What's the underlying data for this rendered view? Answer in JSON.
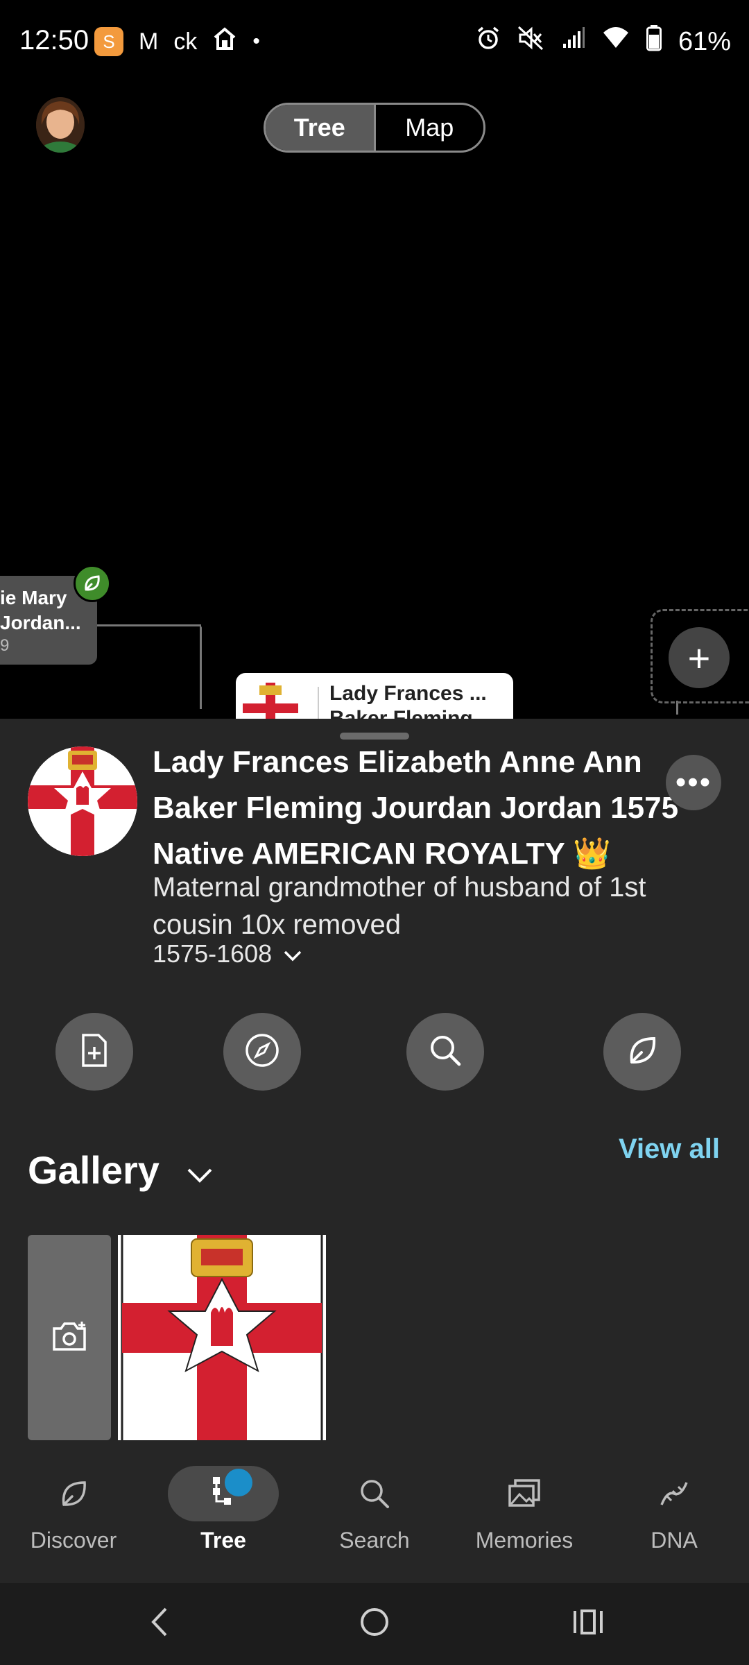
{
  "status_bar": {
    "time": "12:50",
    "badge": "S",
    "gmail_glyph": "M",
    "ck_text": "ck",
    "battery": "61%"
  },
  "header": {
    "tabs": [
      "Tree",
      "Map"
    ],
    "active_tab": "Tree"
  },
  "tree": {
    "left_card": {
      "name_line1": "ie Mary",
      "name_line2": "Jordan...",
      "years": "9"
    },
    "focus_card": {
      "name_line1": "Lady Frances ...",
      "name_line2": "Baker Fleming"
    },
    "add_label": "+"
  },
  "profile": {
    "title": "Lady Frances Elizabeth Anne Ann Baker Fleming Jourdan Jordan 1575 Native AMERICAN ROYALTY 👑",
    "relationship": "Maternal grandmother of husband of 1st cousin 10x removed",
    "dates": "1575-1608",
    "more_label": "•••"
  },
  "actions": [
    {
      "icon": "add-document-icon"
    },
    {
      "icon": "compass-icon"
    },
    {
      "icon": "search-icon"
    },
    {
      "icon": "leaf-hint-icon"
    }
  ],
  "gallery": {
    "title": "Gallery",
    "view_all": "View all"
  },
  "bottom_nav": [
    {
      "label": "Discover",
      "icon": "leaf-icon",
      "active": false
    },
    {
      "label": "Tree",
      "icon": "tree-icon",
      "active": true
    },
    {
      "label": "Search",
      "icon": "search-icon",
      "active": false
    },
    {
      "label": "Memories",
      "icon": "photos-icon",
      "active": false
    },
    {
      "label": "DNA",
      "icon": "dna-icon",
      "active": false
    }
  ],
  "colors": {
    "background": "#000000",
    "sheet": "#262626",
    "accent_link": "#7fd3f0",
    "hint_green": "#3f8c2a",
    "notification_blue": "#1b8ec9",
    "flag_red": "#d32030"
  }
}
